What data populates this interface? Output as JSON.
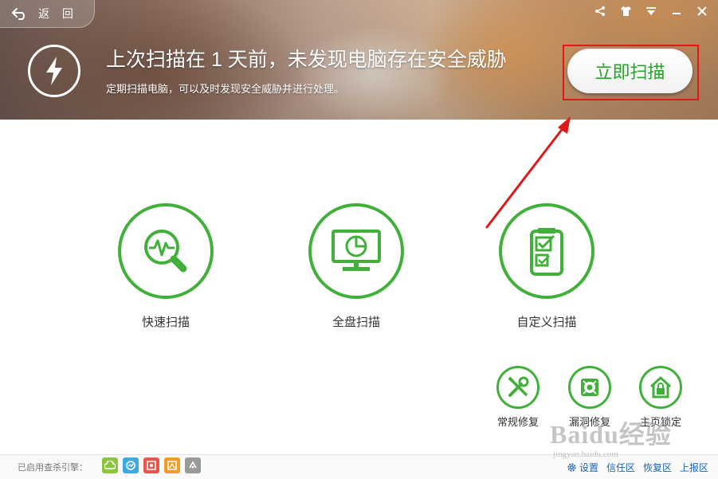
{
  "header": {
    "back_label": "返 回",
    "headline": "上次扫描在 1 天前，未发现电脑存在安全威胁",
    "subline": "定期扫描电脑，可以及时发现安全威胁并进行处理。",
    "scan_now_label": "立即扫描"
  },
  "window_controls": [
    "share-icon",
    "skin-icon",
    "menu-icon",
    "minimize-icon",
    "close-icon"
  ],
  "scan_options": [
    {
      "label": "快速扫描",
      "icon": "quick-scan-icon"
    },
    {
      "label": "全盘扫描",
      "icon": "full-scan-icon"
    },
    {
      "label": "自定义扫描",
      "icon": "custom-scan-icon"
    }
  ],
  "tools": [
    {
      "label": "常规修复",
      "icon": "wrench-screwdriver-icon"
    },
    {
      "label": "漏洞修复",
      "icon": "vulnerability-fix-icon"
    },
    {
      "label": "主页锁定",
      "icon": "home-lock-icon"
    }
  ],
  "footer": {
    "engines_label": "已启用查杀引擎：",
    "engines": [
      {
        "name": "cloud-engine-icon",
        "color": "#8cc63f"
      },
      {
        "name": "qvm-engine-icon",
        "color": "#3fa9e0"
      },
      {
        "name": "system-repair-engine-icon",
        "color": "#e8574a"
      },
      {
        "name": "avira-engine-icon",
        "color": "#f39a2b"
      },
      {
        "name": "bitdefender-engine-icon",
        "color": "#9a9a9a"
      }
    ],
    "settings_label": "设置",
    "links": [
      "信任区",
      "恢复区",
      "上报区"
    ]
  },
  "watermark": {
    "big": "Baidu经验",
    "small": "jingyan.baidu.com"
  },
  "colors": {
    "accent_green": "#41b03a",
    "annotation_red": "#e01818",
    "link_blue": "#1b64b8"
  }
}
